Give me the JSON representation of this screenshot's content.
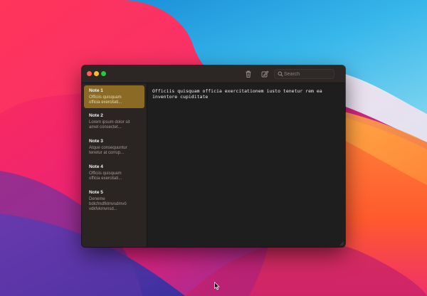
{
  "search": {
    "placeholder": "Search"
  },
  "notes": [
    {
      "title": "Note 1",
      "preview": "Officiis quisquam officia exercitati..."
    },
    {
      "title": "Note 2",
      "preview": "Lorem ipsum dolor sit amet consectet..."
    },
    {
      "title": "Note 3",
      "preview": "Atque consequuntur tenetur at corrup..."
    },
    {
      "title": "Note 4",
      "preview": "Officiis quisquam officia exercitati..."
    },
    {
      "title": "Note 5",
      "preview": "Deneme bdlcfmdfklmvsdmvö vdkfvkmvnsd..."
    }
  ],
  "selected_note_index": 0,
  "editor": {
    "content": "Officiis quisquam officia exercitationem iusto tenetur rem ea\ninventore cupiditate"
  },
  "colors": {
    "selection": "#8a6a24",
    "window_bg": "#1e1e1e",
    "sidebar_bg": "#2a2422",
    "close": "#fe5f57",
    "minimize": "#febc2e",
    "maximize": "#28c840"
  },
  "icons": {
    "toolbar": [
      "trash-icon",
      "compose-icon",
      "search-icon"
    ],
    "cursor": "mouse-pointer-icon"
  }
}
